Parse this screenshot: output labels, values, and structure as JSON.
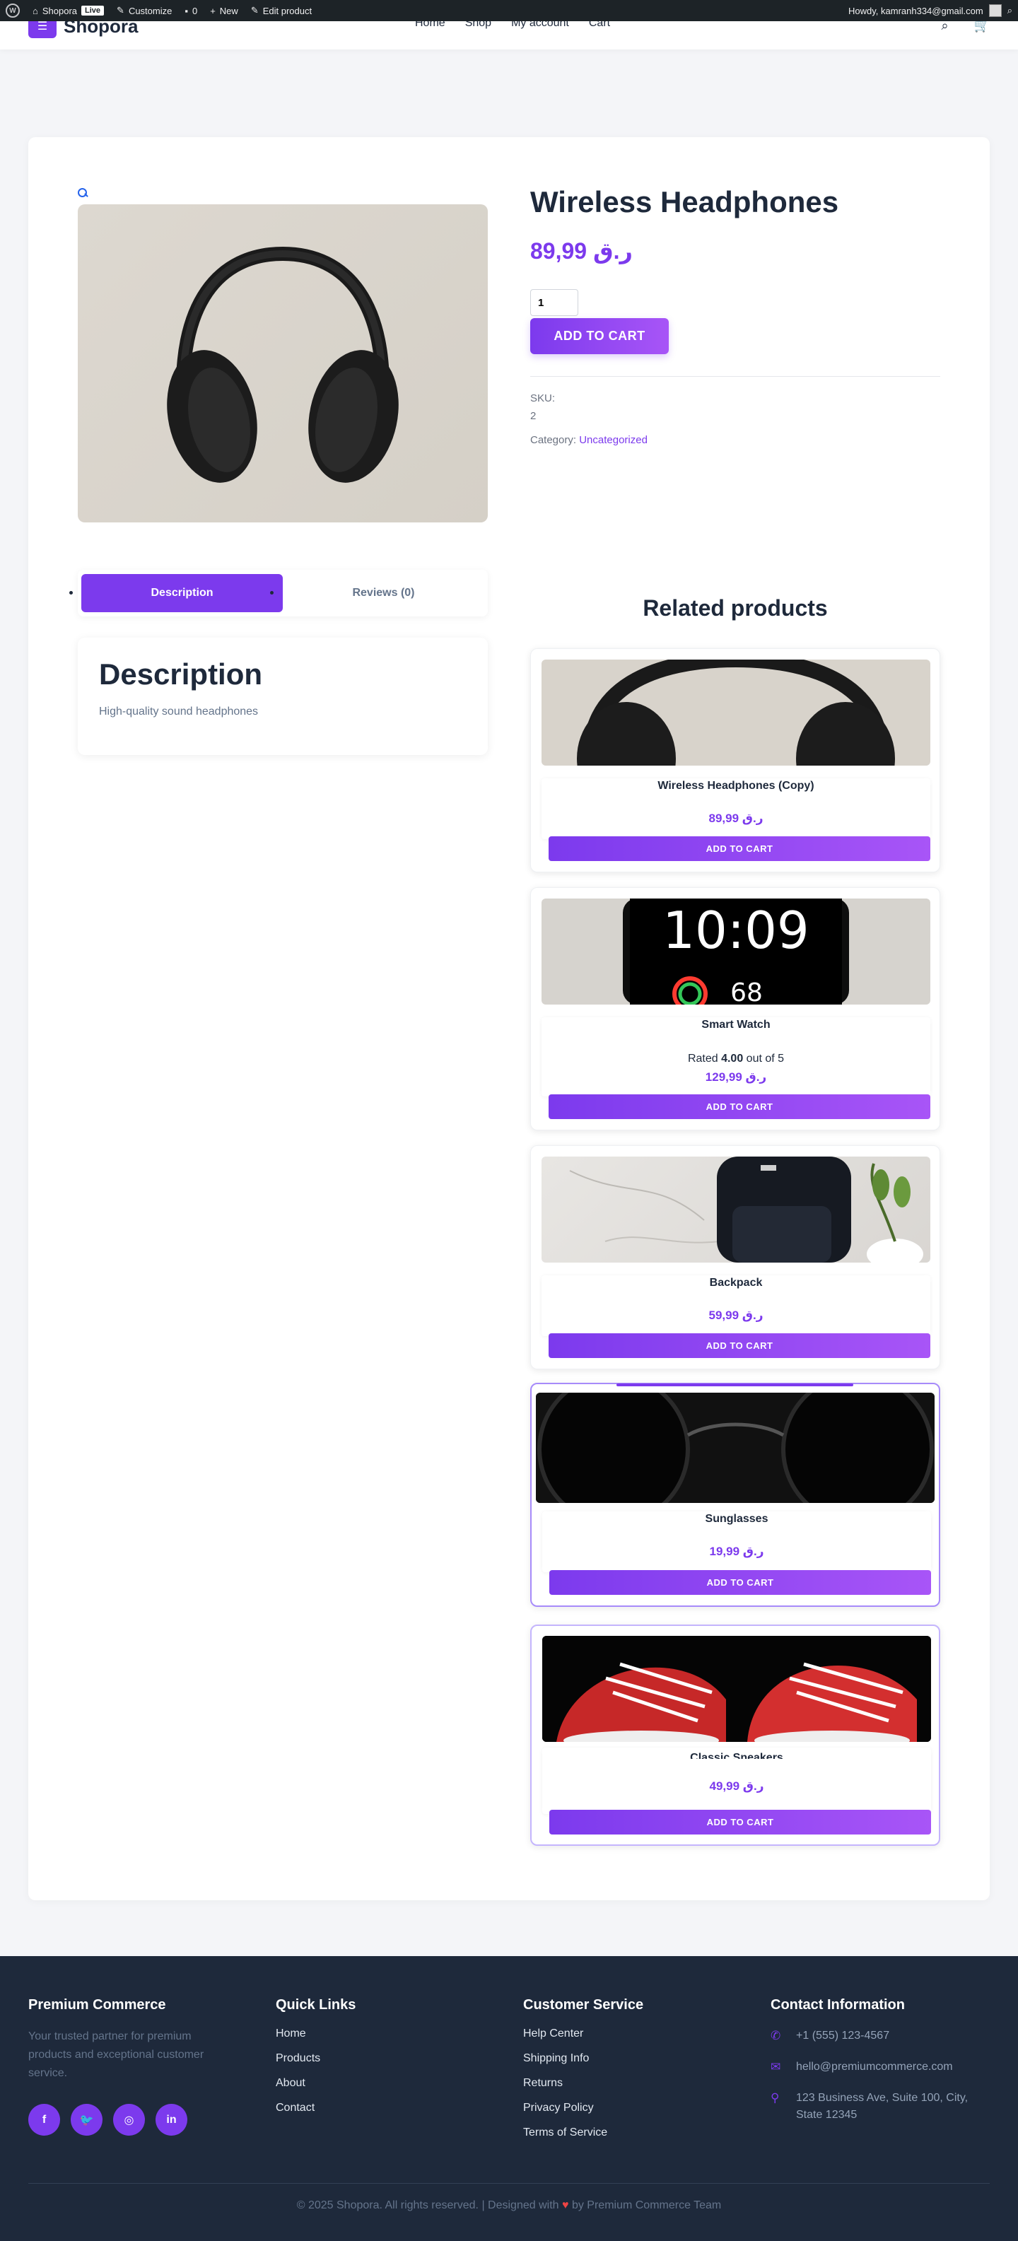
{
  "adminbar": {
    "site_name": "Shopora",
    "live_badge": "Live",
    "customize": "Customize",
    "comments_count": "0",
    "new_label": "New",
    "edit_product": "Edit product",
    "howdy": "Howdy, kamranh334@gmail.com"
  },
  "header": {
    "logo_text": "Shopora",
    "nav": [
      "Home",
      "Shop",
      "My account",
      "Cart"
    ]
  },
  "product": {
    "title": "Wireless Headphones",
    "price": "ر.ق 89,99",
    "quantity": "1",
    "add_to_cart": "ADD TO CART",
    "sku_label": "SKU:",
    "sku_value": "2",
    "category_label": "Category:",
    "category_value": "Uncategorized"
  },
  "tabs": {
    "description": "Description",
    "reviews": "Reviews (0)"
  },
  "description_panel": {
    "title": "Description",
    "text": "High-quality sound headphones"
  },
  "related": {
    "title": "Related products",
    "items": [
      {
        "name": "Wireless Headphones (Copy)",
        "rating": "",
        "price": "ر.ق 89,99",
        "button": "ADD TO CART"
      },
      {
        "name": "Smart Watch",
        "rating_prefix": "Rated ",
        "rating_value": "4.00",
        "rating_suffix": " out of 5",
        "price": "ر.ق 129,99",
        "button": "ADD TO CART"
      },
      {
        "name": "Backpack",
        "price": "ر.ق 59,99",
        "button": "ADD TO CART"
      },
      {
        "name": "Sunglasses",
        "price": "ر.ق 19,99",
        "button": "ADD TO CART"
      },
      {
        "name": "Classic Sneakers",
        "price": "ر.ق 49,99",
        "button": "ADD TO CART"
      }
    ]
  },
  "footer": {
    "about_title": "Premium Commerce",
    "about_text": "Your trusted partner for premium products and exceptional customer service.",
    "quick_title": "Quick Links",
    "quick_links": [
      "Home",
      "Products",
      "About",
      "Contact"
    ],
    "service_title": "Customer Service",
    "service_links": [
      "Help Center",
      "Shipping Info",
      "Returns",
      "Privacy Policy",
      "Terms of Service"
    ],
    "contact_title": "Contact Information",
    "phone": "+1 (555) 123-4567",
    "email": "hello@premiumcommerce.com",
    "address": "123 Business Ave, Suite 100, City, State 12345",
    "copyright_pre": "© 2025 Shopora. All rights reserved. | Designed with ",
    "copyright_post": " by Premium Commerce Team"
  },
  "colors": {
    "accent": "#7c3aed",
    "accent_light": "#a855f7",
    "footer_bg": "#1e293b"
  }
}
